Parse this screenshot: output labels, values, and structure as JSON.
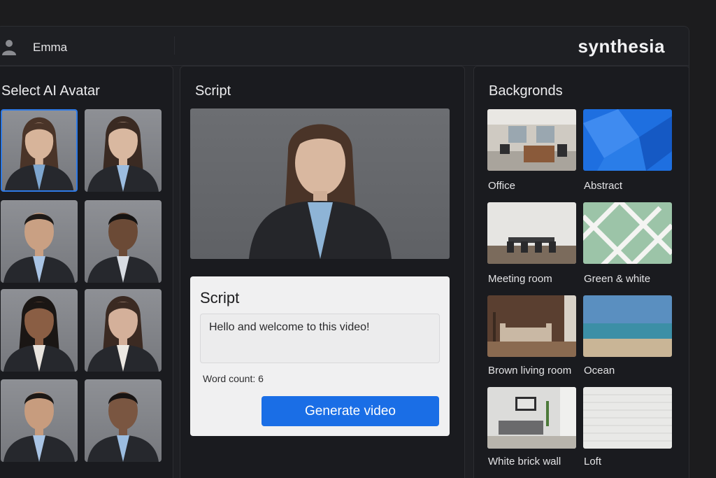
{
  "header": {
    "user_name": "Emma",
    "brand": "synthesia"
  },
  "avatars": {
    "title": "Select AI Avatar",
    "items": [
      {
        "selected": true
      },
      {
        "selected": false
      },
      {
        "selected": false
      },
      {
        "selected": false
      },
      {
        "selected": false
      },
      {
        "selected": false
      },
      {
        "selected": false
      },
      {
        "selected": false
      }
    ]
  },
  "script_panel": {
    "title": "Script",
    "card_title": "Script",
    "text": "Hello and welcome to this video!",
    "word_count": "Word count: 6",
    "generate_label": "Generate video"
  },
  "backgrounds": {
    "title": "Backgronds",
    "items": [
      {
        "label": "Office"
      },
      {
        "label": "Abstract"
      },
      {
        "label": "Meeting room"
      },
      {
        "label": "Green & white"
      },
      {
        "label": "Brown living room"
      },
      {
        "label": "Ocean"
      },
      {
        "label": "White brick wall"
      },
      {
        "label": "Loft"
      }
    ]
  },
  "colors": {
    "accent": "#1a6ee6",
    "selection": "#2f7ae5",
    "background": "#1e1f23"
  }
}
